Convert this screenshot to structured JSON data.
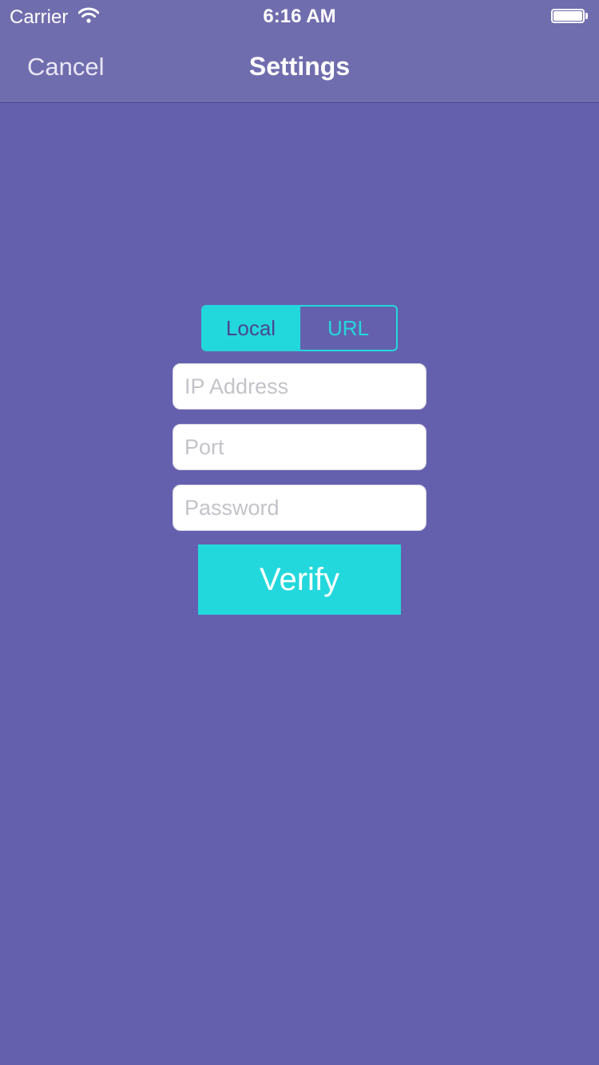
{
  "status_bar": {
    "carrier": "Carrier",
    "time": "6:16 AM"
  },
  "nav": {
    "cancel_label": "Cancel",
    "title": "Settings"
  },
  "segmented_control": {
    "options": [
      "Local",
      "URL"
    ],
    "selected": "Local"
  },
  "form": {
    "ip_placeholder": "IP Address",
    "ip_value": "",
    "port_placeholder": "Port",
    "port_value": "",
    "password_placeholder": "Password",
    "password_value": ""
  },
  "verify_label": "Verify",
  "colors": {
    "background": "#6560ae",
    "nav_background": "#706dae",
    "accent": "#23d8dc",
    "segment_active_text": "#4a4690"
  },
  "icons": {
    "wifi": "wifi-icon",
    "battery": "battery-icon"
  },
  "battery_level": 1.0
}
